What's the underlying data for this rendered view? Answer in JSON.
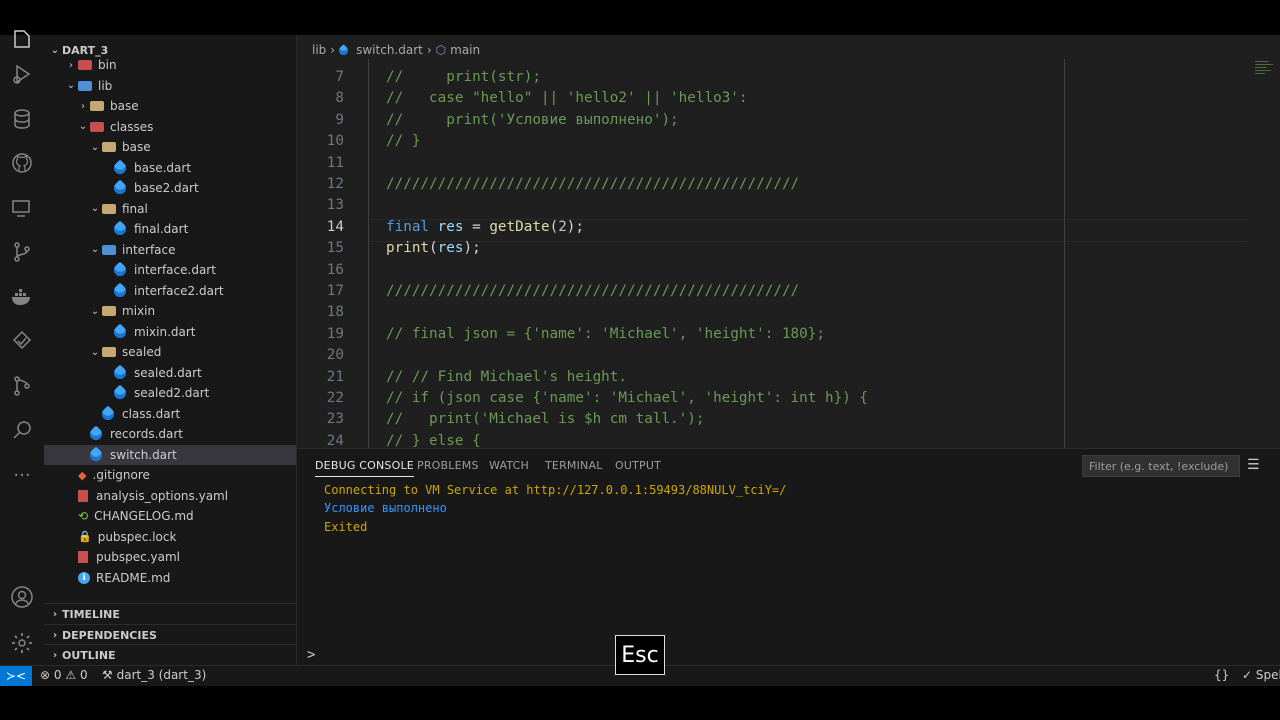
{
  "sidebar": {
    "title": "DART_3",
    "tree": [
      {
        "label": "bin",
        "depth": 1,
        "kind": "folder-red",
        "expanded": false
      },
      {
        "label": "lib",
        "depth": 1,
        "kind": "folder-blue",
        "expanded": true
      },
      {
        "label": "base",
        "depth": 2,
        "kind": "folder-tan",
        "expanded": false
      },
      {
        "label": "classes",
        "depth": 2,
        "kind": "folder-red",
        "expanded": true
      },
      {
        "label": "base",
        "depth": 3,
        "kind": "folder-tan",
        "expanded": true
      },
      {
        "label": "base.dart",
        "depth": 4,
        "kind": "dart"
      },
      {
        "label": "base2.dart",
        "depth": 4,
        "kind": "dart"
      },
      {
        "label": "final",
        "depth": 3,
        "kind": "folder-tan",
        "expanded": true
      },
      {
        "label": "final.dart",
        "depth": 4,
        "kind": "dart"
      },
      {
        "label": "interface",
        "depth": 3,
        "kind": "folder-blue",
        "expanded": true
      },
      {
        "label": "interface.dart",
        "depth": 4,
        "kind": "dart"
      },
      {
        "label": "interface2.dart",
        "depth": 4,
        "kind": "dart"
      },
      {
        "label": "mixin",
        "depth": 3,
        "kind": "folder-tan",
        "expanded": true
      },
      {
        "label": "mixin.dart",
        "depth": 4,
        "kind": "dart"
      },
      {
        "label": "sealed",
        "depth": 3,
        "kind": "folder-tan",
        "expanded": true
      },
      {
        "label": "sealed.dart",
        "depth": 4,
        "kind": "dart"
      },
      {
        "label": "sealed2.dart",
        "depth": 4,
        "kind": "dart"
      },
      {
        "label": "class.dart",
        "depth": 3,
        "kind": "dart"
      },
      {
        "label": "records.dart",
        "depth": 2,
        "kind": "dart"
      },
      {
        "label": "switch.dart",
        "depth": 2,
        "kind": "dart",
        "active": true
      },
      {
        "label": ".gitignore",
        "depth": 1,
        "kind": "git"
      },
      {
        "label": "analysis_options.yaml",
        "depth": 1,
        "kind": "yaml"
      },
      {
        "label": "CHANGELOG.md",
        "depth": 1,
        "kind": "changelog"
      },
      {
        "label": "pubspec.lock",
        "depth": 1,
        "kind": "lock"
      },
      {
        "label": "pubspec.yaml",
        "depth": 1,
        "kind": "yaml"
      },
      {
        "label": "README.md",
        "depth": 1,
        "kind": "info"
      }
    ],
    "sections": [
      "TIMELINE",
      "DEPENDENCIES",
      "OUTLINE"
    ]
  },
  "editor": {
    "breadcrumb": [
      "lib",
      "switch.dart",
      "main"
    ],
    "current_line": 14,
    "lines": [
      {
        "n": 7,
        "text": "//     print(str);",
        "kind": "comment"
      },
      {
        "n": 8,
        "text": "//   case \"hello\" || 'hello2' || 'hello3':",
        "kind": "comment"
      },
      {
        "n": 9,
        "text": "//     print('Условие выполнено');",
        "kind": "comment"
      },
      {
        "n": 10,
        "text": "// }",
        "kind": "comment"
      },
      {
        "n": 11,
        "text": "",
        "kind": "blank"
      },
      {
        "n": 12,
        "text": "////////////////////////////////////////////////",
        "kind": "comment"
      },
      {
        "n": 13,
        "text": "",
        "kind": "blank"
      },
      {
        "n": 14,
        "text": "final res = getDate(2);",
        "kind": "code"
      },
      {
        "n": 15,
        "text": "print(res);",
        "kind": "code"
      },
      {
        "n": 16,
        "text": "",
        "kind": "blank"
      },
      {
        "n": 17,
        "text": "////////////////////////////////////////////////",
        "kind": "comment"
      },
      {
        "n": 18,
        "text": "",
        "kind": "blank"
      },
      {
        "n": 19,
        "text": "// final json = {'name': 'Michael', 'height': 180};",
        "kind": "comment"
      },
      {
        "n": 20,
        "text": "",
        "kind": "blank"
      },
      {
        "n": 21,
        "text": "// // Find Michael's height.",
        "kind": "comment"
      },
      {
        "n": 22,
        "text": "// if (json case {'name': 'Michael', 'height': int h}) {",
        "kind": "comment"
      },
      {
        "n": 23,
        "text": "//   print('Michael is $h cm tall.');",
        "kind": "comment"
      },
      {
        "n": 24,
        "text": "// } else {",
        "kind": "comment"
      }
    ],
    "code14": {
      "kw": "final",
      "var": "res",
      "eq": " = ",
      "fn": "getDate",
      "open": "(",
      "num": "2",
      "close": ");"
    },
    "code15": {
      "fn": "print",
      "open": "(",
      "var": "res",
      "close": ");"
    }
  },
  "panel": {
    "tabs": [
      "DEBUG CONSOLE",
      "PROBLEMS",
      "WATCH",
      "TERMINAL",
      "OUTPUT"
    ],
    "active_tab": "DEBUG CONSOLE",
    "filter_placeholder": "Filter (e.g. text, !exclude)",
    "output": [
      {
        "text": "Connecting to VM Service at http://127.0.0.1:59493/88NULV_tciY=/",
        "color": "#cca700"
      },
      {
        "text": "Условие выполнено",
        "color": "#3794ff"
      },
      {
        "text": "Exited",
        "color": "#cca700"
      }
    ],
    "prompt": ">"
  },
  "statusbar": {
    "errors": "0",
    "warnings": "0",
    "project": "dart_3 (dart_3)",
    "braces": "{}",
    "spell": "Spel"
  },
  "overlay": {
    "key": "Esc"
  }
}
